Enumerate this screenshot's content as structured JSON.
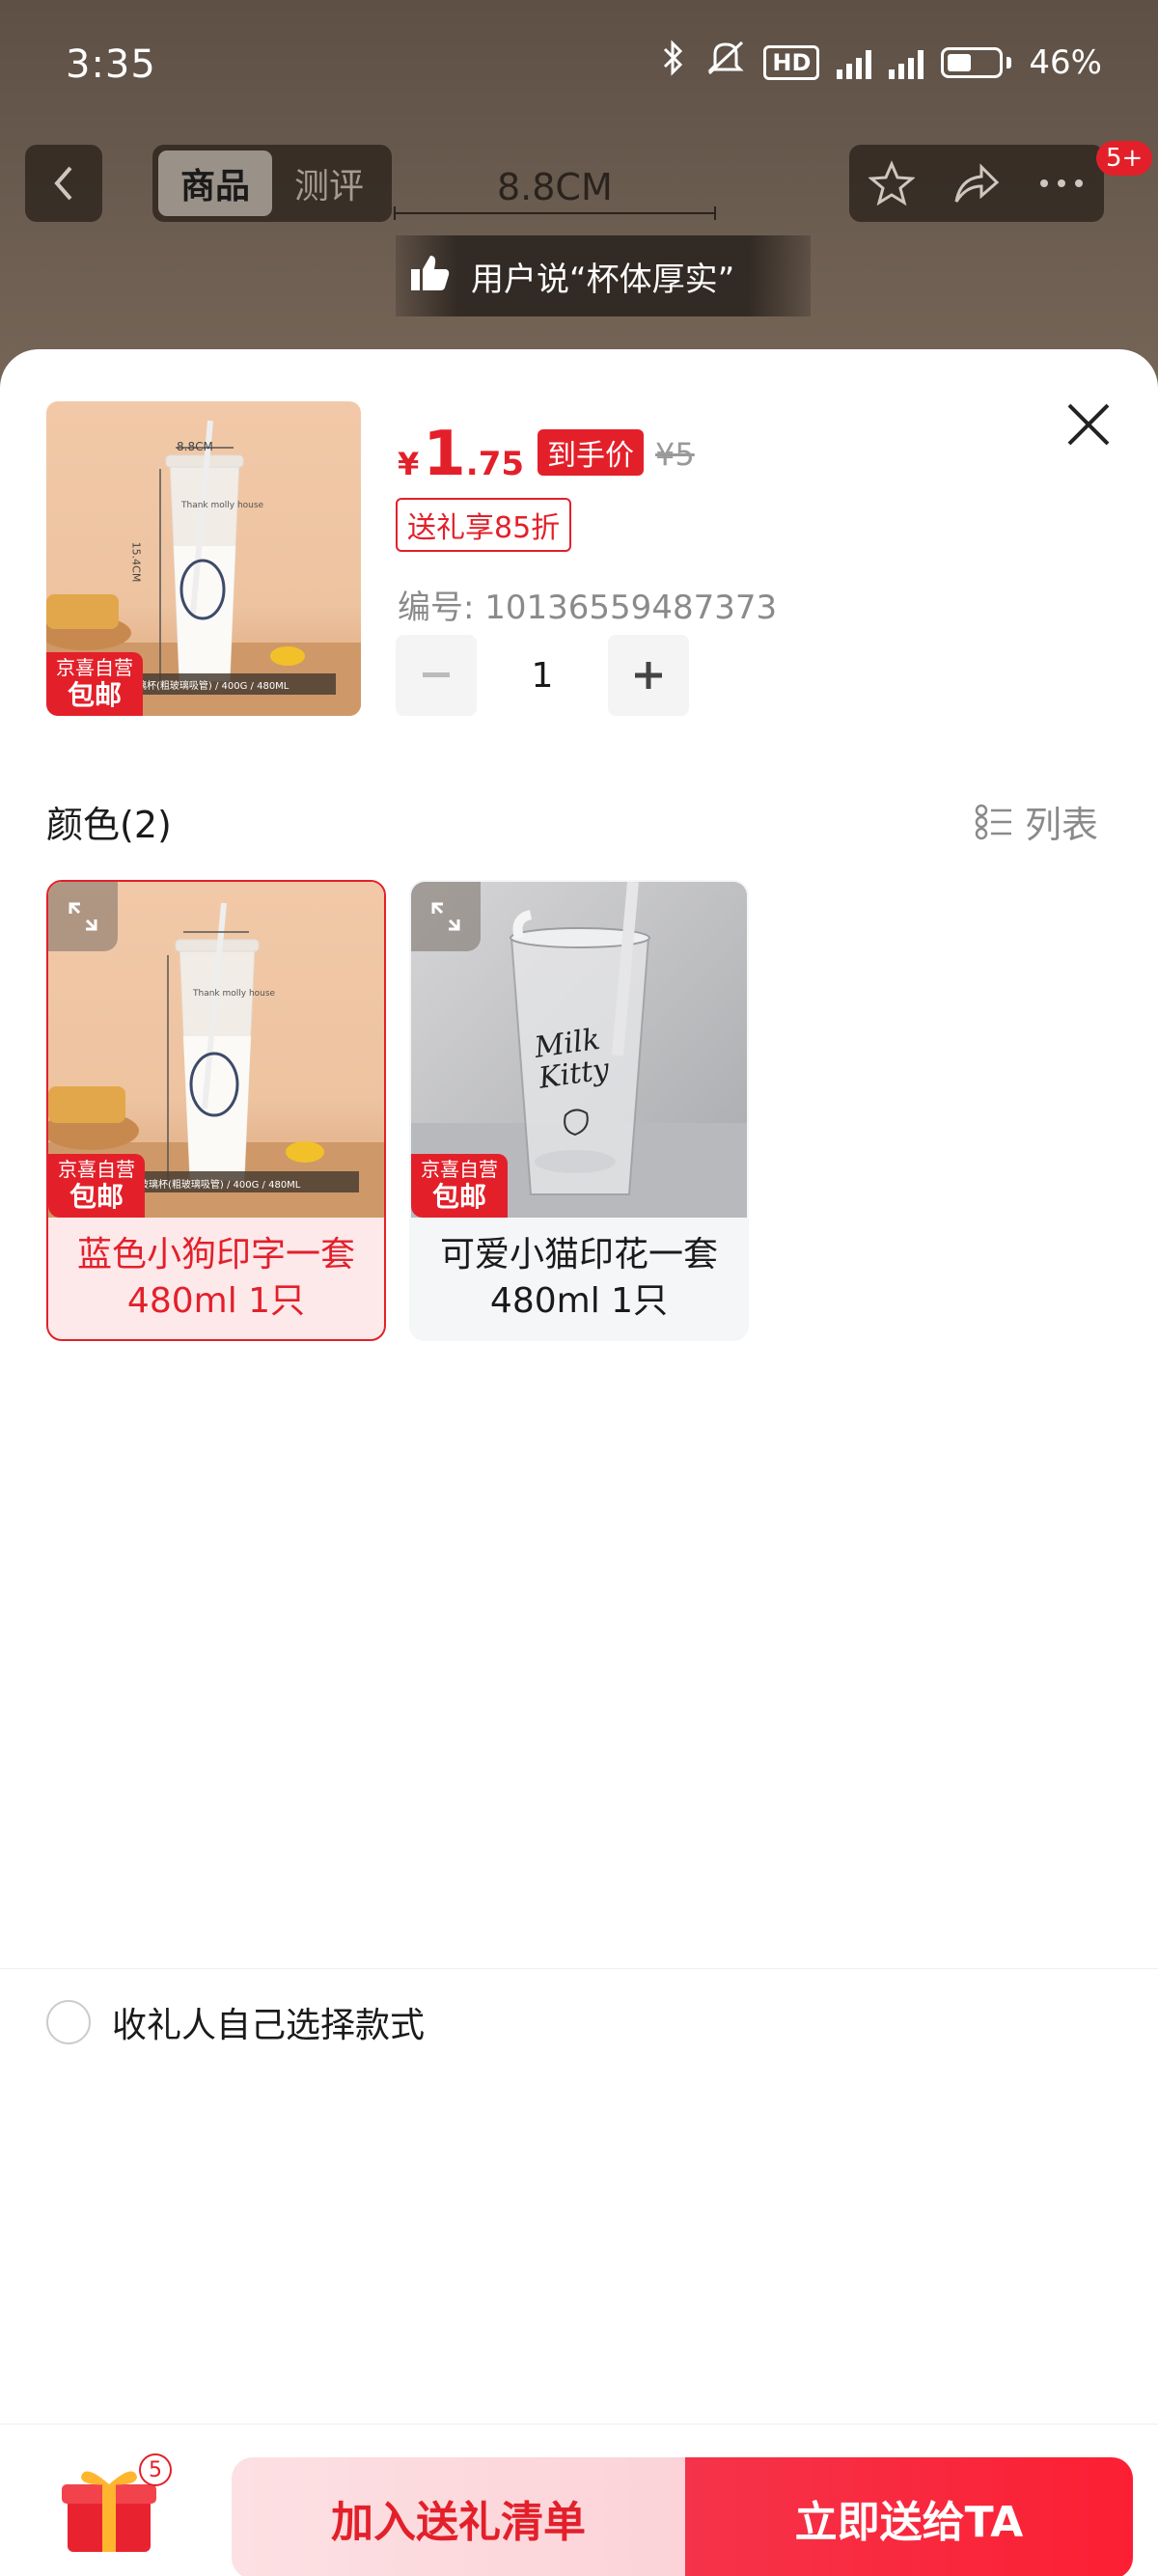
{
  "status_bar": {
    "time": "3:35",
    "network": "5G",
    "battery": "46%"
  },
  "nav": {
    "tabs": [
      "商品",
      "测评"
    ],
    "badge": "5+"
  },
  "background": {
    "dimension_label": "8.8CM",
    "review_banner": "用户说“杯体厚实”"
  },
  "product": {
    "price_symbol": "¥",
    "price_int": "1",
    "price_dec": ".75",
    "price_tag": "到手价",
    "price_original": "¥5",
    "discount_tag": "送礼享85折",
    "item_id": "编号: 10136559487373",
    "quantity": "1",
    "image": {
      "badge_top": "京喜自营",
      "badge_bottom": "包邮",
      "dim_top": "8.8CM",
      "dim_side": "15.4CM",
      "caption": "玻璃杯(粗玻璃吸管) / 400G / 480ML"
    }
  },
  "colors_section": {
    "title": "颜色(2)",
    "list_toggle": "列表",
    "variants": [
      {
        "label": "蓝色小狗印字一套480ml 1只",
        "badge_top": "京喜自营",
        "badge_bottom": "包邮",
        "selected": true,
        "caption": "玻璃杯(粗玻璃吸管) / 400G / 480ML"
      },
      {
        "label": "可爱小猫印花一套480ml 1只",
        "badge_top": "京喜自营",
        "badge_bottom": "包邮",
        "selected": false,
        "cup_text": "Milk Kitty"
      }
    ]
  },
  "gift_option": {
    "label": "收礼人自己选择款式"
  },
  "footer": {
    "gift_count": "5",
    "add_button": "加入送礼清单",
    "send_button": "立即送给TA"
  },
  "colors": {
    "accent": "#e3202a",
    "selected_bg": "#fde8ea"
  }
}
